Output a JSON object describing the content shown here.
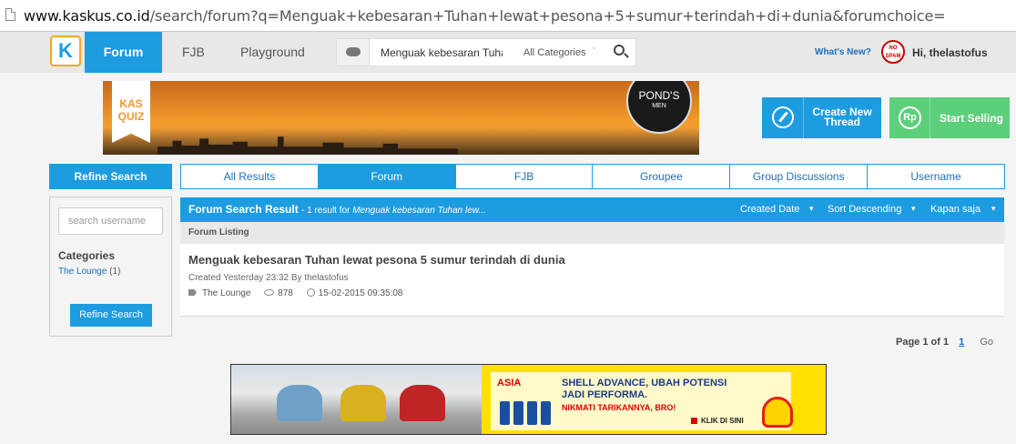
{
  "browser": {
    "url_host": "www.kaskus.co.id",
    "url_rest": "/search/forum?q=Menguak+kebesaran+Tuhan+lewat+pesona+5+sumur+terindah+di+dunia&forumchoice="
  },
  "nav": {
    "forum": "Forum",
    "fjb": "FJB",
    "playground": "Playground",
    "search_query": "Menguak kebesaran Tuhan",
    "category": "All Categories",
    "whats_new": "What's New?",
    "avatar_text": "NO SPAM",
    "greeting": "Hi, thelastofus"
  },
  "banner": {
    "kasquiz": "KAS QUIZ",
    "brand": "POND'S",
    "brand_sub": "MEN"
  },
  "actions": {
    "create_thread": "Create New Thread",
    "sell_icon": "Rp",
    "start_selling": "Start Selling"
  },
  "refine": {
    "header": "Refine Search",
    "username_placeholder": "search username",
    "categories_title": "Categories",
    "category_name": "The Lounge",
    "category_count": "(1)",
    "button": "Refine Search"
  },
  "tabs": [
    "All Results",
    "Forum",
    "FJB",
    "Groupee",
    "Group Discussions",
    "Username"
  ],
  "results": {
    "title": "Forum Search Result",
    "meta_prefix": "- 1 result for",
    "meta_query": "Menguak kebesaran Tuhan lew...",
    "sort_created": "Created Date",
    "sort_order": "Sort Descending",
    "sort_time": "Kapan saja",
    "listing_label": "Forum Listing",
    "item": {
      "title": "Menguak kebesaran Tuhan lewat pesona 5 sumur terindah di dunia",
      "created": "Created Yesterday 23:32 By thelastofus",
      "category": "The Lounge",
      "views": "878",
      "date": "15-02-2015 09:35:08"
    }
  },
  "pager": {
    "label": "Page 1 of 1",
    "page": "1",
    "go": "Go"
  },
  "ad": {
    "asia": "ASIA",
    "headline": "SHELL ADVANCE, UBAH POTENSI JADI PERFORMA.",
    "subline": "NIKMATI TARIKANNYA, BRO!",
    "cta": "KLIK DI SINI"
  },
  "colors": {
    "accent": "#1d9ce0",
    "sell": "#5ccf7b",
    "link": "#1d6fb8"
  }
}
